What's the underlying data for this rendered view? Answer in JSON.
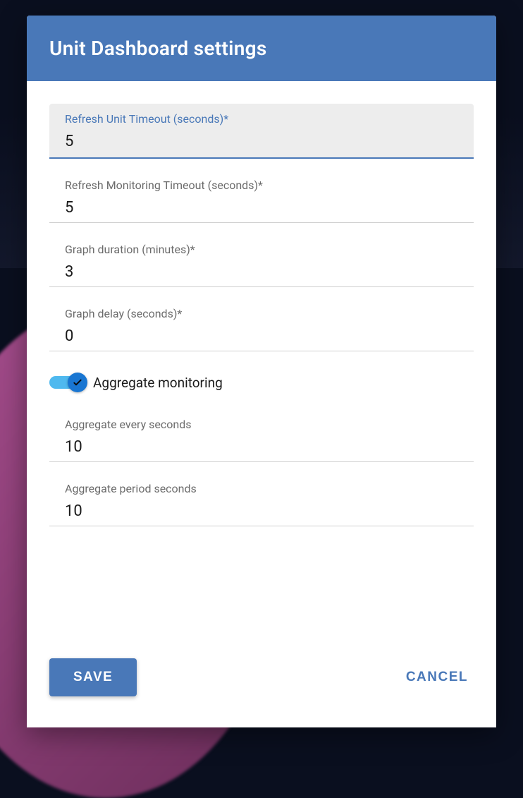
{
  "modal": {
    "title": "Unit Dashboard settings",
    "fields": {
      "refresh_unit": {
        "label": "Refresh Unit Timeout (seconds)*",
        "value": "5"
      },
      "refresh_monitoring": {
        "label": "Refresh Monitoring Timeout (seconds)*",
        "value": "5"
      },
      "graph_duration": {
        "label": "Graph duration (minutes)*",
        "value": "3"
      },
      "graph_delay": {
        "label": "Graph delay (seconds)*",
        "value": "0"
      },
      "aggregate_every": {
        "label": "Aggregate every seconds",
        "value": "10"
      },
      "aggregate_period": {
        "label": "Aggregate period seconds",
        "value": "10"
      }
    },
    "toggle": {
      "label": "Aggregate monitoring",
      "checked": true
    },
    "buttons": {
      "save": "SAVE",
      "cancel": "CANCEL"
    }
  }
}
